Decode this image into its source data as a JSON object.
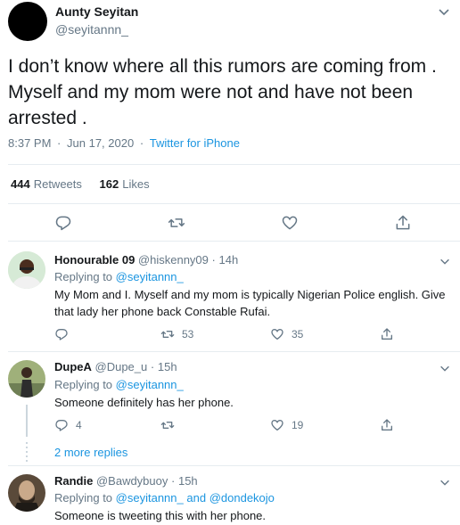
{
  "main_tweet": {
    "name": "Aunty Seyitan",
    "handle": "@seyitannn_",
    "text": "I don’t know where all this rumors are coming from . Myself and my mom were not and have not been arrested .",
    "time": "8:37 PM",
    "date": "Jun 17, 2020",
    "separator": "·",
    "source": "Twitter for iPhone",
    "retweets_count": "444",
    "retweets_label": "Retweets",
    "likes_count": "162",
    "likes_label": "Likes"
  },
  "replies": [
    {
      "name": "Honourable 09",
      "handle": "@hiskenny09",
      "age": "14h",
      "replying_prefix": "Replying to",
      "replying_to": "@seyitannn_",
      "replying_joiner": "",
      "replying_to_2": "",
      "text": "My Mom and I. Myself and my mom is typically Nigerian Police english. Give that lady her phone back Constable Rufai.",
      "reply_count": "",
      "retweet_count": "53",
      "like_count": "35"
    },
    {
      "name": "DupeA",
      "handle": "@Dupe_u",
      "age": "15h",
      "replying_prefix": "Replying to",
      "replying_to": "@seyitannn_",
      "replying_joiner": "",
      "replying_to_2": "",
      "text": "Someone definitely has her phone.",
      "reply_count": "4",
      "retweet_count": "",
      "like_count": "19"
    },
    {
      "name": "Randie",
      "handle": "@Bawdybuoy",
      "age": "15h",
      "replying_prefix": "Replying to",
      "replying_to": "@seyitannn_",
      "replying_joiner": "and",
      "replying_to_2": "@dondekojo",
      "text": "Someone is tweeting this with her phone."
    }
  ],
  "more_replies": "2 more replies",
  "icons": [
    "reply-icon",
    "retweet-icon",
    "like-icon",
    "share-icon",
    "chevron-down-icon"
  ],
  "colors": {
    "link": "#1b95e0",
    "muted": "#657786",
    "text": "#14171a",
    "border": "#e6ecf0"
  }
}
